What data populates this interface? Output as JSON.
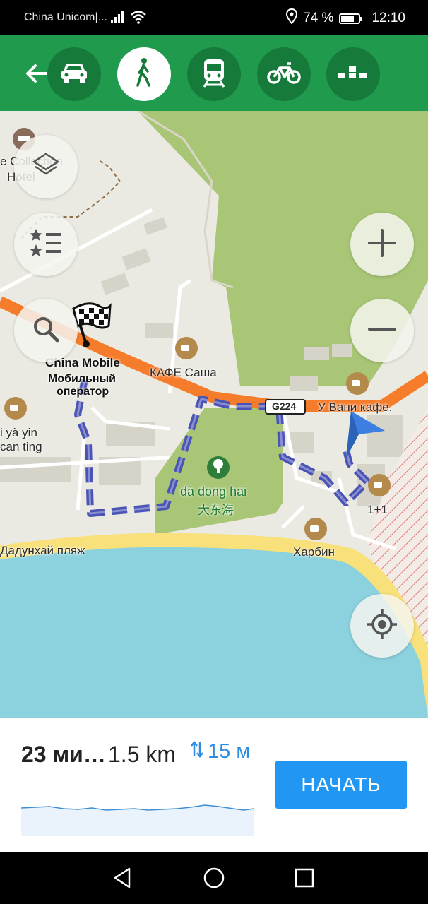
{
  "status_bar": {
    "carrier": "China Unicom|...",
    "battery_percent": "74 %",
    "battery_level": 0.74,
    "time": "12:10",
    "icons": [
      "signal-icon",
      "wifi-icon",
      "location-icon",
      "battery-icon"
    ]
  },
  "top_bar": {
    "back_icon": "back-arrow-icon",
    "modes": [
      {
        "name": "car",
        "icon": "car-icon",
        "active": false
      },
      {
        "name": "walk",
        "icon": "walk-icon",
        "active": true
      },
      {
        "name": "transit",
        "icon": "train-icon",
        "active": false
      },
      {
        "name": "bike",
        "icon": "bike-icon",
        "active": false
      },
      {
        "name": "taxi",
        "icon": "taxi-icon",
        "active": false
      }
    ],
    "color": "#209a4c"
  },
  "map": {
    "labels": {
      "hotel_line1": "e Collection",
      "hotel_line2": "Hotel",
      "china_mobile": "China Mobile",
      "operator_line1": "Мобильный",
      "operator_line2": "оператор",
      "cafe_sasha": "КАФЕ Саша",
      "road_label": "G224",
      "vani_cafe": "У Вани кафе.",
      "yi_ya_yin_1": "i yà yin",
      "yi_ya_yin_2": "can ting",
      "park_latin": "dà dong hai",
      "park_chinese": "大东海",
      "one_plus_one": "1+1",
      "harbin": "Харбин",
      "beach": "Дадунхай пляж"
    },
    "colors": {
      "road": "#f57c2a",
      "route": "#4a54b5",
      "park": "#a8c676",
      "sea": "#8cd1de",
      "beach": "#f8e07a"
    }
  },
  "map_controls": {
    "layers_icon": "layers-icon",
    "favorites_icon": "favorites-list-icon",
    "search_icon": "search-icon",
    "zoom_in_icon": "plus-icon",
    "zoom_out_icon": "minus-icon",
    "locate_icon": "my-location-icon"
  },
  "route_summary": {
    "time": "23 ми…",
    "distance": "1.5 km",
    "climb": "15 м",
    "start_label": "НАЧАТЬ"
  },
  "nav_bar": {
    "icons": [
      "back-triangle-icon",
      "home-circle-icon",
      "recents-square-icon"
    ]
  }
}
